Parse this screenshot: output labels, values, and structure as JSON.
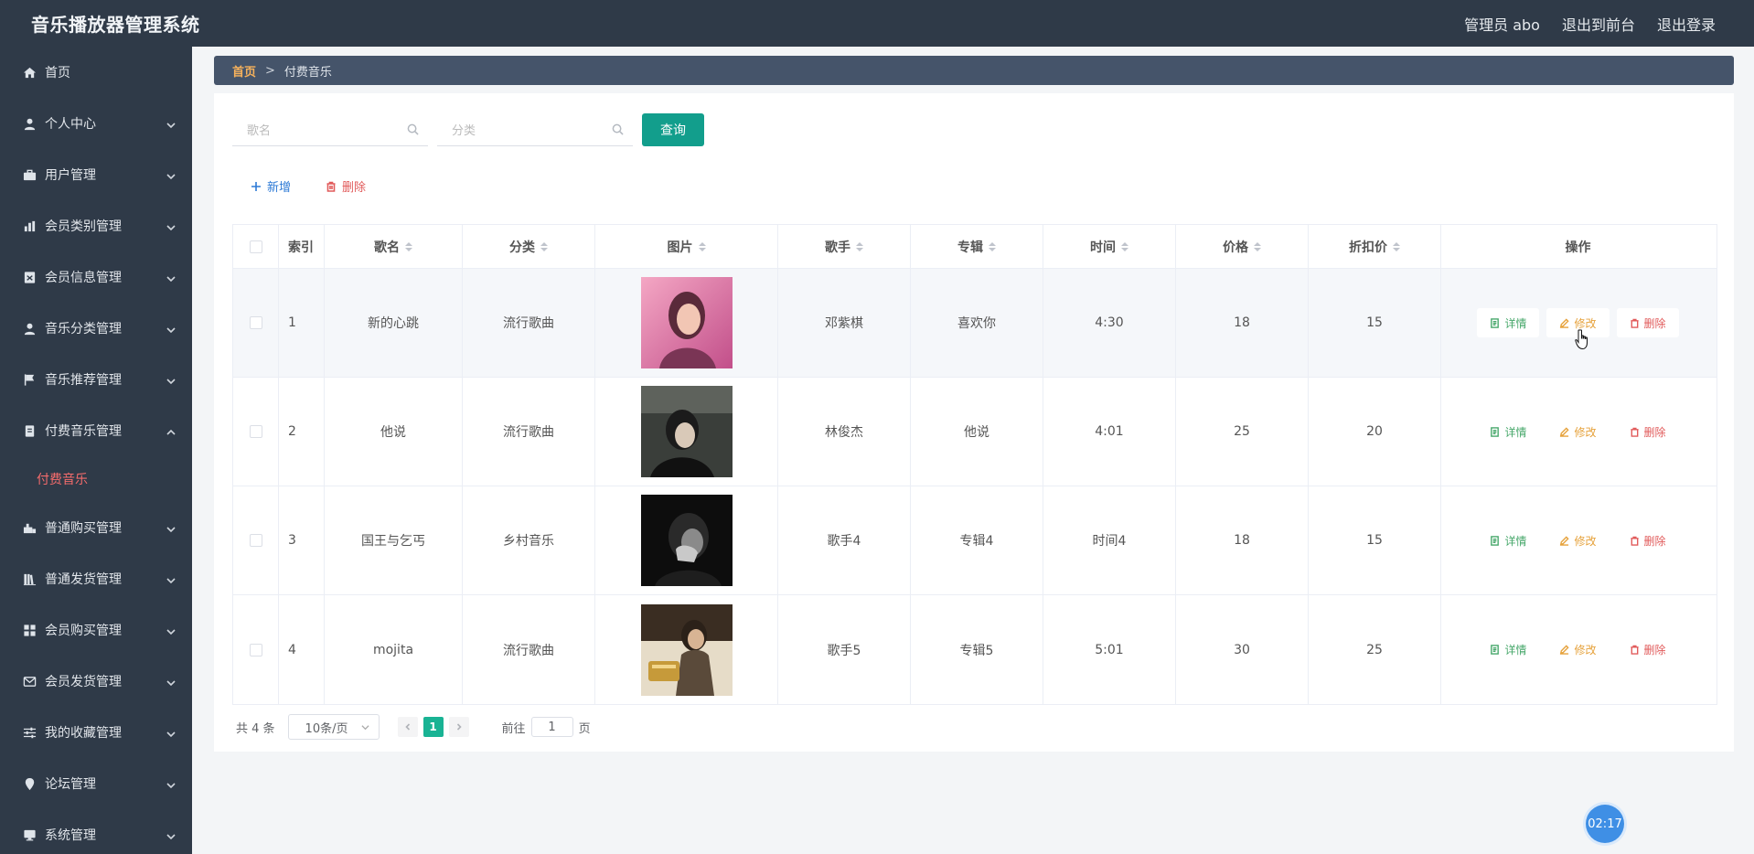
{
  "app": {
    "title": "音乐播放器管理系统"
  },
  "topnav": {
    "admin": "管理员 abo",
    "front": "退出到前台",
    "logout": "退出登录"
  },
  "sidebar": {
    "items": [
      {
        "label": "首页",
        "icon": "home-icon",
        "expandable": false
      },
      {
        "label": "个人中心",
        "icon": "user-icon",
        "expandable": true
      },
      {
        "label": "用户管理",
        "icon": "briefcase-icon",
        "expandable": true
      },
      {
        "label": "会员类别管理",
        "icon": "bar-chart-icon",
        "expandable": true
      },
      {
        "label": "会员信息管理",
        "icon": "id-card-icon",
        "expandable": true
      },
      {
        "label": "音乐分类管理",
        "icon": "user-icon",
        "expandable": true
      },
      {
        "label": "音乐推荐管理",
        "icon": "flag-icon",
        "expandable": true
      },
      {
        "label": "付费音乐管理",
        "icon": "document-icon",
        "expandable": true,
        "open": true
      },
      {
        "label": "普通购买管理",
        "icon": "cart-icon",
        "expandable": true
      },
      {
        "label": "普通发货管理",
        "icon": "books-icon",
        "expandable": true
      },
      {
        "label": "会员购买管理",
        "icon": "grid-icon",
        "expandable": true
      },
      {
        "label": "会员发货管理",
        "icon": "mail-icon",
        "expandable": true
      },
      {
        "label": "我的收藏管理",
        "icon": "sliders-icon",
        "expandable": true
      },
      {
        "label": "论坛管理",
        "icon": "pin-icon",
        "expandable": true
      },
      {
        "label": "系统管理",
        "icon": "display-icon",
        "expandable": true
      }
    ],
    "active_sub": "付费音乐"
  },
  "breadcrumb": {
    "home": "首页",
    "sep": ">",
    "current": "付费音乐"
  },
  "search": {
    "name_placeholder": "歌名",
    "category_placeholder": "分类",
    "query_label": "查询"
  },
  "actions": {
    "add_label": "新增",
    "delete_label": "删除"
  },
  "table": {
    "headers": {
      "index": "索引",
      "name": "歌名",
      "category": "分类",
      "picture": "图片",
      "singer": "歌手",
      "album": "专辑",
      "time": "时间",
      "price": "价格",
      "discount": "折扣价",
      "ops": "操作"
    },
    "rows": [
      {
        "index": "1",
        "name": "新的心跳",
        "category": "流行歌曲",
        "singer": "邓紫棋",
        "album": "喜欢你",
        "time": "4:30",
        "price": "18",
        "discount": "15"
      },
      {
        "index": "2",
        "name": "他说",
        "category": "流行歌曲",
        "singer": "林俊杰",
        "album": "他说",
        "time": "4:01",
        "price": "25",
        "discount": "20"
      },
      {
        "index": "3",
        "name": "国王与乞丐",
        "category": "乡村音乐",
        "singer": "歌手4",
        "album": "专辑4",
        "time": "时间4",
        "price": "18",
        "discount": "15"
      },
      {
        "index": "4",
        "name": "mojita",
        "category": "流行歌曲",
        "singer": "歌手5",
        "album": "专辑5",
        "time": "5:01",
        "price": "30",
        "discount": "25"
      }
    ],
    "op_labels": {
      "view": "详情",
      "edit": "修改",
      "remove": "删除"
    }
  },
  "pagination": {
    "total": "共 4 条",
    "page_size": "10条/页",
    "current_page": "1",
    "goto_prefix": "前往",
    "goto_value": "1",
    "goto_suffix": "页"
  },
  "timer": {
    "value": "02:17"
  },
  "colors": {
    "sidebar_bg": "#2f3a48",
    "primary_green": "#129e8c",
    "active_red": "#f56c6c",
    "page_active": "#19b394"
  }
}
